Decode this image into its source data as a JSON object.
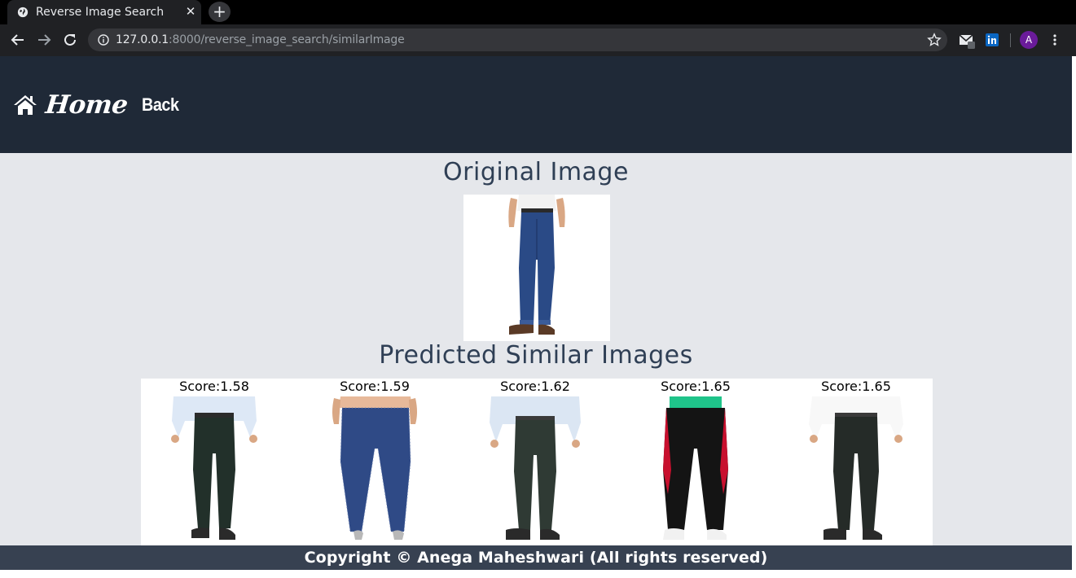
{
  "browser": {
    "tab_title": "Reverse Image Search",
    "tab_close": "✕",
    "new_tab": "+",
    "url_host": "127.0.0.1",
    "url_path": ":8000/reverse_image_search/similarImage",
    "profile_initial": "A"
  },
  "navbar": {
    "home_label": "Home",
    "back_label": "Back"
  },
  "original": {
    "title": "Original Image"
  },
  "similar": {
    "title": "Predicted Similar Images",
    "results": [
      {
        "score": "Score:1.58",
        "image": "white-shirt-dark-trousers"
      },
      {
        "score": "Score:1.59",
        "image": "blue-speckled-jeans"
      },
      {
        "score": "Score:1.62",
        "image": "white-shirt-grey-trousers"
      },
      {
        "score": "Score:1.65",
        "image": "black-track-pants"
      },
      {
        "score": "Score:1.65",
        "image": "white-shirt-charcoal-trousers"
      }
    ]
  },
  "footer": {
    "text": "Copyright © Anega Maheshwari (All rights reserved)"
  },
  "colors": {
    "navbar": "#1f2937",
    "content_bg": "#e5e7eb",
    "footer": "#374151",
    "title_text": "#2f3f55"
  }
}
